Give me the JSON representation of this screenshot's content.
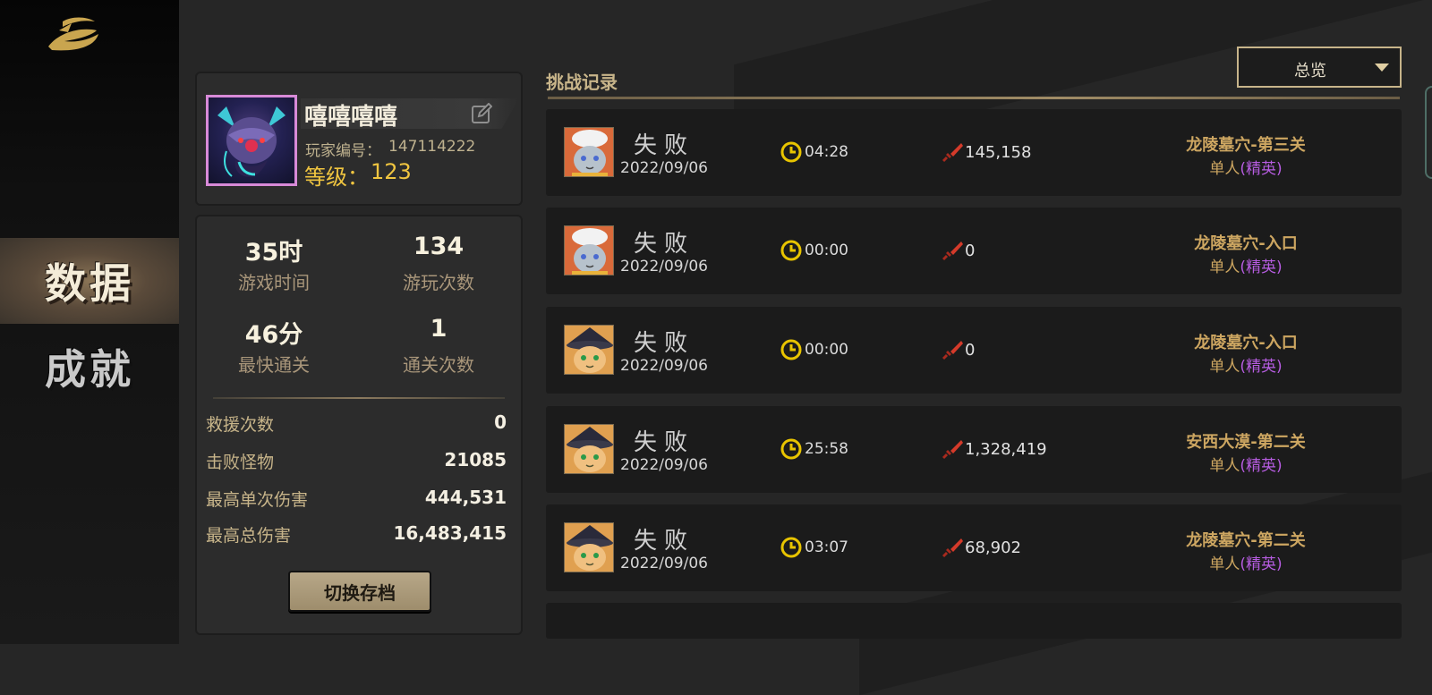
{
  "nav": {
    "data_label": "数据",
    "achievements_label": "成就"
  },
  "profile": {
    "name": "嘻嘻嘻嘻",
    "player_id_label": "玩家编号：",
    "player_id": "147114222",
    "level_label": "等级：",
    "level": "123"
  },
  "stats": {
    "play_time_value": "35时",
    "play_time_label": "游戏时间",
    "play_count_value": "134",
    "play_count_label": "游玩次数",
    "fastest_clear_value": "46分",
    "fastest_clear_label": "最快通关",
    "clear_count_value": "1",
    "clear_count_label": "通关次数",
    "rows": [
      {
        "label": "救援次数",
        "value": "0"
      },
      {
        "label": "击败怪物",
        "value": "21085"
      },
      {
        "label": "最高单次伤害",
        "value": "444,531"
      },
      {
        "label": "最高总伤害",
        "value": "16,483,415"
      }
    ],
    "switch_save_label": "切换存档"
  },
  "records": {
    "title": "挑战记录",
    "filter_selected": "总览",
    "items": [
      {
        "result": "失败",
        "date": "2022/09/06",
        "time": "04:28",
        "damage": "145,158",
        "stage": "龙陵墓穴-第三关",
        "mode": "单人",
        "difficulty": "(精英)",
        "avatar": "chef-cat-icon"
      },
      {
        "result": "失败",
        "date": "2022/09/06",
        "time": "00:00",
        "damage": "0",
        "stage": "龙陵墓穴-入口",
        "mode": "单人",
        "difficulty": "(精英)",
        "avatar": "chef-cat-icon"
      },
      {
        "result": "失败",
        "date": "2022/09/06",
        "time": "00:00",
        "damage": "0",
        "stage": "龙陵墓穴-入口",
        "mode": "单人",
        "difficulty": "(精英)",
        "avatar": "witch-cat-icon"
      },
      {
        "result": "失败",
        "date": "2022/09/06",
        "time": "25:58",
        "damage": "1,328,419",
        "stage": "安西大漠-第二关",
        "mode": "单人",
        "difficulty": "(精英)",
        "avatar": "witch-cat-icon"
      },
      {
        "result": "失败",
        "date": "2022/09/06",
        "time": "03:07",
        "damage": "68,902",
        "stage": "龙陵墓穴-第二关",
        "mode": "单人",
        "difficulty": "(精英)",
        "avatar": "witch-cat-icon"
      }
    ]
  },
  "colors": {
    "gold": "#f0c540",
    "tan": "#c8b58a",
    "elite_purple": "#b65ce0",
    "avatar_border": "#d88ad8"
  }
}
